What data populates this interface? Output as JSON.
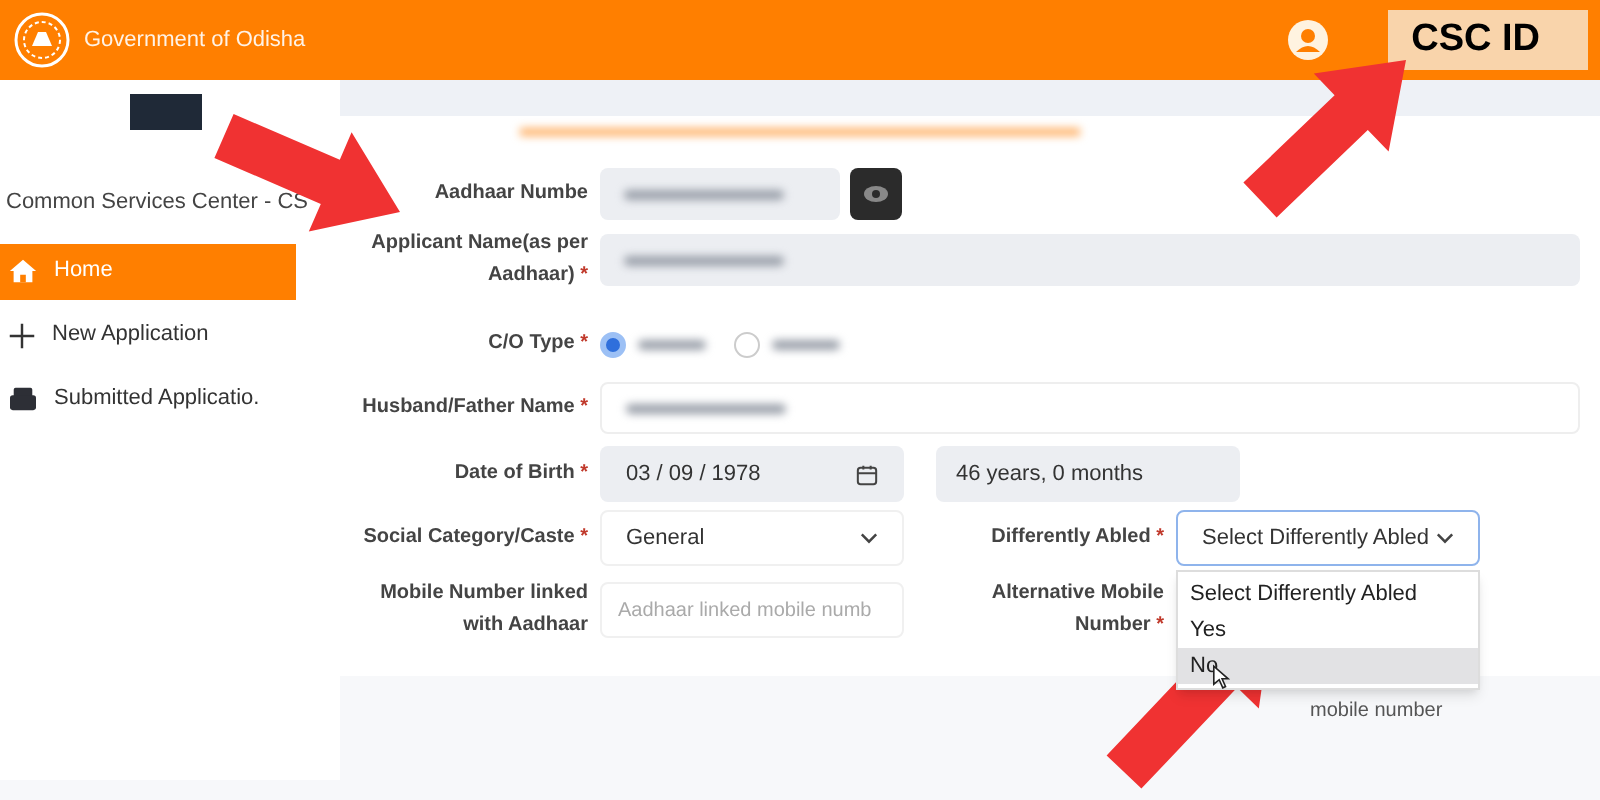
{
  "header": {
    "title": "Government of Odisha",
    "user_id": "CSC ID"
  },
  "sidebar": {
    "title": "Common Services Center - CS",
    "items": [
      {
        "label": "Home",
        "kind": "home",
        "selected": true
      },
      {
        "label": "New Application",
        "kind": "plus",
        "selected": false
      },
      {
        "label": "Submitted Applicatio.",
        "kind": "tray",
        "selected": false
      }
    ]
  },
  "form": {
    "aadhaar": {
      "label": "Aadhaar Numbe",
      "redacted": true
    },
    "applicant_name": {
      "label": "Applicant Name(as per Aadhaar)",
      "marker": "*",
      "redacted": true
    },
    "co_type": {
      "label": "C/O Type",
      "marker": "*",
      "options": [
        {
          "selected": true
        },
        {
          "selected": false
        }
      ]
    },
    "husband_father_name": {
      "label": "Husband/Father Name",
      "marker": "*",
      "redacted": true
    },
    "date_of_birth": {
      "label": "Date of Birth",
      "marker": "*",
      "value": "03 / 09 / 1978",
      "age": "46 years, 0 months"
    },
    "social_category": {
      "label": "Social Category/Caste",
      "marker": "*",
      "value": "General"
    },
    "differently_abled": {
      "label": "Differently Abled",
      "marker": "*",
      "value": "Select Differently Abled",
      "expanded": true,
      "options": [
        {
          "label": "Select Differently Abled",
          "highlighted": false
        },
        {
          "label": "Yes",
          "highlighted": false
        },
        {
          "label": "No",
          "highlighted": true
        }
      ]
    },
    "mobile": {
      "label": "Mobile Number linked with Aadhaar",
      "placeholder": "Aadhaar linked mobile numb"
    },
    "alt_mobile": {
      "label": "Alternative Mobile Number",
      "marker": "*",
      "hint": "mobile number"
    }
  },
  "annotations": [
    {
      "kind": "arrow"
    },
    {
      "kind": "arrow"
    },
    {
      "kind": "arrow"
    }
  ]
}
